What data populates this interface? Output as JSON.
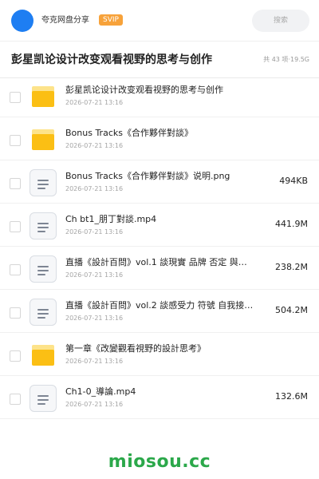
{
  "header": {
    "owner": "夸克网盘分享",
    "badge": "SVIP",
    "search_placeholder": "搜索"
  },
  "share": {
    "title": "彭星凯论设计改变观看视野的思考与创作",
    "count": "共 43 项",
    "separator": " · ",
    "total_size": "19.5G"
  },
  "files": [
    {
      "type": "folder",
      "name": "彭星凯论设计改变观看视野的思考与创作",
      "date": "2026-07-21 13:16",
      "size": ""
    },
    {
      "type": "folder",
      "name": "Bonus Tracks《合作夥伴對談》",
      "date": "2026-07-21 13:16",
      "size": ""
    },
    {
      "type": "file",
      "name": "Bonus Tracks《合作夥伴對談》说明.png",
      "date": "2026-07-21 13:16",
      "size": "494KB"
    },
    {
      "type": "file",
      "name": "Ch bt1_朋丁對談.mp4",
      "date": "2026-07-21 13:16",
      "size": "441.9M"
    },
    {
      "type": "file",
      "name": "直播《設計百問》vol.1 談現實 品牌 否定 與…",
      "date": "2026-07-21 13:16",
      "size": "238.2M"
    },
    {
      "type": "file",
      "name": "直播《設計百問》vol.2 談感受力 符號 自我接…",
      "date": "2026-07-21 13:16",
      "size": "504.2M"
    },
    {
      "type": "folder",
      "name": "第一章《改變觀看視野的設計思考》",
      "date": "2026-07-21 13:16",
      "size": ""
    },
    {
      "type": "file",
      "name": "Ch1-0_導論.mp4",
      "date": "2026-07-21 13:16",
      "size": "132.6M"
    }
  ],
  "watermark": "miosou.cc",
  "icons": {
    "folder": "folder-icon",
    "file": "document-icon"
  },
  "colors": {
    "avatar": "#1e7ef2",
    "svip": "#f7a23a",
    "folder": "#fbbf14",
    "watermark": "#2ba84a"
  }
}
